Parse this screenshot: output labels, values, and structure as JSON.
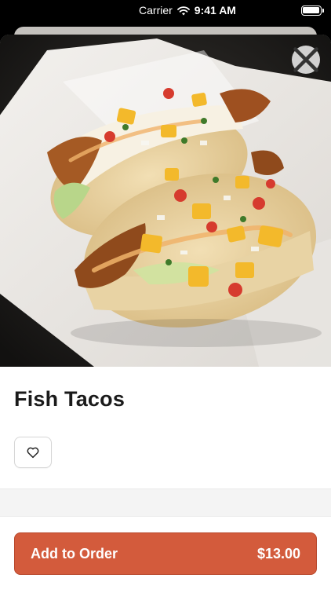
{
  "status_bar": {
    "carrier": "Carrier",
    "time": "9:41 AM"
  },
  "item": {
    "title": "Fish Tacos",
    "image_alt": "Fish tacos with mango salsa"
  },
  "order": {
    "button_label": "Add to Order",
    "price": "$13.00"
  },
  "colors": {
    "accent": "#d35b3c",
    "accent_border": "#b8482c",
    "title_text": "#1a1a1a",
    "divider_band": "#f4f4f4"
  },
  "icons": {
    "close": "close-icon",
    "favorite": "heart-icon",
    "wifi": "wifi-icon",
    "battery": "battery-icon"
  }
}
